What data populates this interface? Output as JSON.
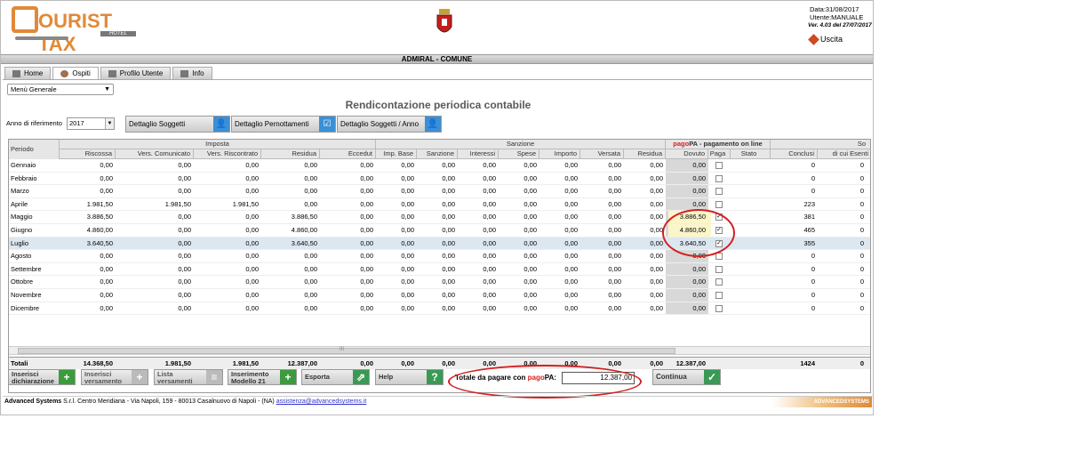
{
  "header": {
    "logo_text": "OURIST TAX",
    "logo_sub": "HOTEL",
    "date": "Data:31/08/2017",
    "user": "Utente:MANUALE",
    "version": "Ver. 4.03 del 27/07/2017",
    "logout": "Uscita"
  },
  "title_bar": "ADMIRAL - COMUNE",
  "tabs": [
    {
      "label": "Home"
    },
    {
      "label": "Ospiti"
    },
    {
      "label": "Profilo Utente"
    },
    {
      "label": "Info"
    }
  ],
  "menu": {
    "value": "Menù Generale"
  },
  "page_title": "Rendicontazione periodica contabile",
  "year": {
    "label": "Anno di riferimento",
    "value": "2017"
  },
  "detail_buttons": [
    "Dettaglio Soggetti",
    "Dettaglio Pernottamenti",
    "Dettaglio Soggetti / Anno"
  ],
  "grid": {
    "group_headers": {
      "periodo": "Periodo",
      "imposta": "Imposta",
      "sanzione": "Sanzione",
      "pagopa_pre": "pago",
      "pagopa_pa": "PA",
      "pagopa_post": " - pagamento on line",
      "so": "So"
    },
    "columns": [
      "Riscossa",
      "Vers. Comunicato",
      "Vers. Riscontrato",
      "Residua",
      "Eccedut",
      "Imp. Base",
      "Sanzione",
      "Interessi",
      "Spese",
      "Importo",
      "Versata",
      "Residua",
      "Dovuto",
      "Paga",
      "Stato",
      "Conclusi",
      "di cui Esenti"
    ],
    "rows": [
      {
        "periodo": "Gennaio",
        "v": [
          "0,00",
          "0,00",
          "0,00",
          "0,00",
          "0,00",
          "0,00",
          "0,00",
          "0,00",
          "0,00",
          "0,00",
          "0,00",
          "0,00",
          "0,00"
        ],
        "paga": "",
        "conclusi": "0",
        "esenti": "0"
      },
      {
        "periodo": "Febbraio",
        "v": [
          "0,00",
          "0,00",
          "0,00",
          "0,00",
          "0,00",
          "0,00",
          "0,00",
          "0,00",
          "0,00",
          "0,00",
          "0,00",
          "0,00",
          "0,00"
        ],
        "paga": "",
        "conclusi": "0",
        "esenti": "0"
      },
      {
        "periodo": "Marzo",
        "v": [
          "0,00",
          "0,00",
          "0,00",
          "0,00",
          "0,00",
          "0,00",
          "0,00",
          "0,00",
          "0,00",
          "0,00",
          "0,00",
          "0,00",
          "0,00"
        ],
        "paga": "",
        "conclusi": "0",
        "esenti": "0"
      },
      {
        "periodo": "Aprile",
        "v": [
          "1.981,50",
          "1.981,50",
          "1.981,50",
          "0,00",
          "0,00",
          "0,00",
          "0,00",
          "0,00",
          "0,00",
          "0,00",
          "0,00",
          "0,00",
          "0,00"
        ],
        "paga": "",
        "conclusi": "223",
        "esenti": "0"
      },
      {
        "periodo": "Maggio",
        "v": [
          "3.886,50",
          "0,00",
          "0,00",
          "3.886,50",
          "0,00",
          "0,00",
          "0,00",
          "0,00",
          "0,00",
          "0,00",
          "0,00",
          "0,00",
          "3.886,50"
        ],
        "paga": "✓",
        "conclusi": "381",
        "esenti": "0"
      },
      {
        "periodo": "Giugno",
        "v": [
          "4.860,00",
          "0,00",
          "0,00",
          "4.860,00",
          "0,00",
          "0,00",
          "0,00",
          "0,00",
          "0,00",
          "0,00",
          "0,00",
          "0,00",
          "4.860,00"
        ],
        "paga": "✓",
        "conclusi": "465",
        "esenti": "0"
      },
      {
        "periodo": "Luglio",
        "v": [
          "3.640,50",
          "0,00",
          "0,00",
          "3.640,50",
          "0,00",
          "0,00",
          "0,00",
          "0,00",
          "0,00",
          "0,00",
          "0,00",
          "0,00",
          "3.640,50"
        ],
        "paga": "✓",
        "conclusi": "355",
        "esenti": "0"
      },
      {
        "periodo": "Agosto",
        "v": [
          "0,00",
          "0,00",
          "0,00",
          "0,00",
          "0,00",
          "0,00",
          "0,00",
          "0,00",
          "0,00",
          "0,00",
          "0,00",
          "0,00",
          "0,00"
        ],
        "paga": "",
        "conclusi": "0",
        "esenti": "0"
      },
      {
        "periodo": "Settembre",
        "v": [
          "0,00",
          "0,00",
          "0,00",
          "0,00",
          "0,00",
          "0,00",
          "0,00",
          "0,00",
          "0,00",
          "0,00",
          "0,00",
          "0,00",
          "0,00"
        ],
        "paga": "",
        "conclusi": "0",
        "esenti": "0"
      },
      {
        "periodo": "Ottobre",
        "v": [
          "0,00",
          "0,00",
          "0,00",
          "0,00",
          "0,00",
          "0,00",
          "0,00",
          "0,00",
          "0,00",
          "0,00",
          "0,00",
          "0,00",
          "0,00"
        ],
        "paga": "",
        "conclusi": "0",
        "esenti": "0"
      },
      {
        "periodo": "Novembre",
        "v": [
          "0,00",
          "0,00",
          "0,00",
          "0,00",
          "0,00",
          "0,00",
          "0,00",
          "0,00",
          "0,00",
          "0,00",
          "0,00",
          "0,00",
          "0,00"
        ],
        "paga": "",
        "conclusi": "0",
        "esenti": "0"
      },
      {
        "periodo": "Dicembre",
        "v": [
          "0,00",
          "0,00",
          "0,00",
          "0,00",
          "0,00",
          "0,00",
          "0,00",
          "0,00",
          "0,00",
          "0,00",
          "0,00",
          "0,00",
          "0,00"
        ],
        "paga": "",
        "conclusi": "0",
        "esenti": "0"
      }
    ],
    "totals": {
      "label": "Totali",
      "v": [
        "14.368,50",
        "1.981,50",
        "1.981,50",
        "12.387,00",
        "0,00",
        "0,00",
        "0,00",
        "0,00",
        "0,00",
        "0,00",
        "0,00",
        "0,00",
        "12.387,00"
      ],
      "conclusi": "1424",
      "esenti": "0"
    },
    "scroll_mid": "III"
  },
  "actions": {
    "inserisci_dich": [
      "Inserisci",
      "dichiarazione"
    ],
    "inserisci_vers": [
      "Inserisci",
      "versamento"
    ],
    "lista_vers": [
      "Lista",
      "versamenti"
    ],
    "modello21": [
      "Inserimento",
      "Modello 21"
    ],
    "esporta": "Esporta",
    "help": "Help",
    "totale_pre": "Totale da pagare con ",
    "totale_pago": "pago",
    "totale_pa": "PA:",
    "totale_value": "12.387,00",
    "continua": "Continua"
  },
  "footer": {
    "company": "Advanced Systems",
    "address": " S.r.l. Centro Meridiana - Via Napoli, 159 - 80013 Casalnuovo di Napoli - (NA) ",
    "email": "assistenza@advancedsystems.it",
    "brand": "ADVANCEDSYSTEMS"
  },
  "colors": {
    "accent": "#e08a38",
    "highlight_red": "#d42020",
    "selected_row": "#dce7f0",
    "button_green": "#3c9b3c"
  }
}
